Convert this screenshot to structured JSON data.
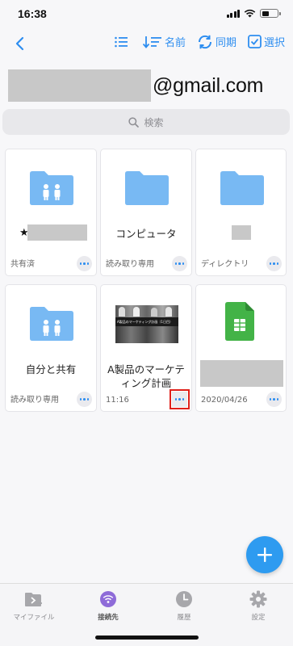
{
  "status_bar": {
    "time": "16:38"
  },
  "nav": {
    "toolbar": [
      {
        "icon": "list-icon",
        "label": ""
      },
      {
        "icon": "sort-icon",
        "label": "名前"
      },
      {
        "icon": "sync-icon",
        "label": "同期"
      },
      {
        "icon": "select-checkbox-icon",
        "label": "選択"
      }
    ]
  },
  "account": {
    "email_domain": "@gmail.com"
  },
  "search": {
    "placeholder": "検索"
  },
  "files": [
    {
      "name_prefix": "★",
      "name": "",
      "meta": "共有済",
      "icon": "shared-folder-icon"
    },
    {
      "name": "コンピュータ",
      "meta": "読み取り専用",
      "icon": "folder-icon"
    },
    {
      "name": "",
      "meta": "ディレクトリ",
      "icon": "folder-icon"
    },
    {
      "name": "自分と共有",
      "meta": "読み取り専用",
      "icon": "shared-folder-icon"
    },
    {
      "name": "A製品のマーケティング計画",
      "meta": "11:16",
      "icon": "video-thumbnail",
      "thumbnail_text": "A製品のマーケティング計画（1日目）"
    },
    {
      "name": "",
      "meta": "2020/04/26",
      "icon": "spreadsheet-icon"
    }
  ],
  "tab_bar": {
    "items": [
      {
        "label": "マイファイル",
        "icon": "my-files-icon",
        "active": false
      },
      {
        "label": "接続先",
        "icon": "wifi-icon",
        "active": true
      },
      {
        "label": "履歴",
        "icon": "clock-icon",
        "active": false
      },
      {
        "label": "設定",
        "icon": "gear-icon",
        "active": false
      }
    ]
  },
  "colors": {
    "accent": "#2e8ef0",
    "folder": "#78b9f3",
    "sheet": "#4caf50",
    "fab": "#2e9bf0"
  }
}
